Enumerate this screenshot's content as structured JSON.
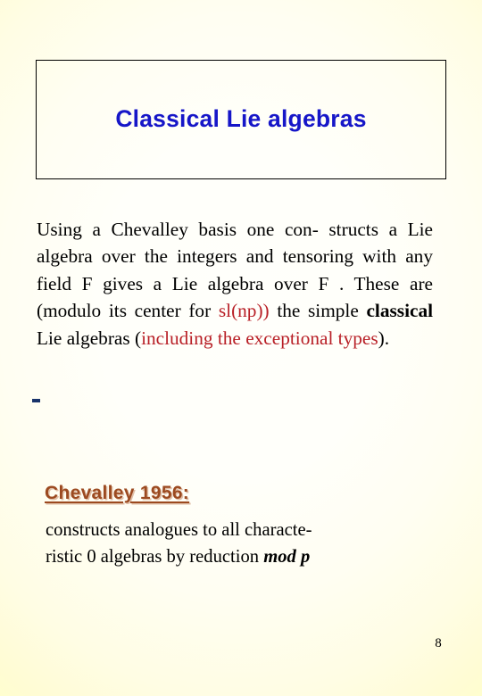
{
  "slide": {
    "background_color": "#ffffcc",
    "canvas_color": "#fffffb",
    "page_number": "8"
  },
  "title": {
    "text": "Classical Lie algebras",
    "color": "#1616c8"
  },
  "body": {
    "line1": "Using a Chevalley basis one con-",
    "line2": "structs a Lie algebra over the integers",
    "line3": "and tensoring with any field F gives a",
    "line4": "Lie algebra over F . These are (modulo",
    "line5_a": "its center for ",
    "line5_red": "sl(np))",
    "line5_b": " the simple",
    "line6_bold": "classical",
    "line6_a": " Lie algebras (",
    "line6_red": "including the",
    "line7_red": "exceptional types",
    "line7_b": ").",
    "accent_red": "#b81f26",
    "marker_color": "#19336b"
  },
  "subheading": {
    "text": "Chevalley 1956:",
    "color": "#9c4a20"
  },
  "subbody": {
    "line1": "constructs analogues to all characte-",
    "line2_a": "ristic 0 algebras by reduction ",
    "line2_em": "mod p"
  }
}
